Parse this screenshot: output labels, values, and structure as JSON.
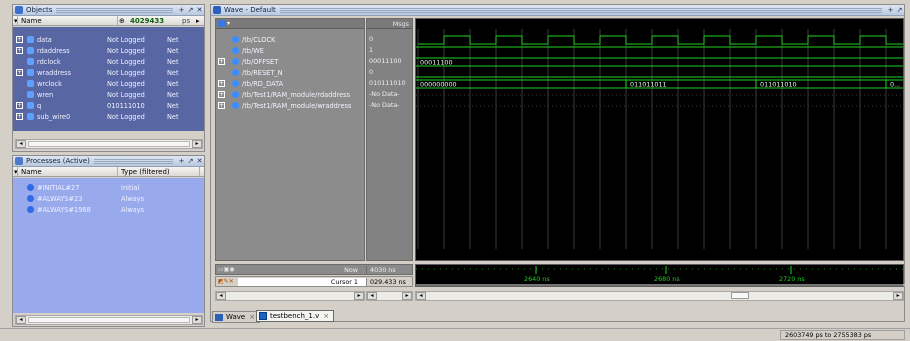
{
  "objects": {
    "title": "Objects",
    "col_name": "Name",
    "search_value": "4029433",
    "search_unit": "ps",
    "rows": [
      {
        "name": "data",
        "value": "Not Logged",
        "kind": "Net",
        "expand": true
      },
      {
        "name": "rdaddress",
        "value": "Not Logged",
        "kind": "Net",
        "expand": true
      },
      {
        "name": "rdclock",
        "value": "Not Logged",
        "kind": "Net",
        "expand": false
      },
      {
        "name": "wraddress",
        "value": "Not Logged",
        "kind": "Net",
        "expand": true
      },
      {
        "name": "wrclock",
        "value": "Not Logged",
        "kind": "Net",
        "expand": false
      },
      {
        "name": "wren",
        "value": "Not Logged",
        "kind": "Net",
        "expand": false
      },
      {
        "name": "q",
        "value": "010111010",
        "kind": "Net",
        "expand": true
      },
      {
        "name": "sub_wire0",
        "value": "Not Logged",
        "kind": "Net",
        "expand": true
      }
    ]
  },
  "processes": {
    "title": "Processes (Active)",
    "col_name": "Name",
    "col_type": "Type (filtered)",
    "rows": [
      {
        "name": "#INITIAL#27",
        "type": "Initial"
      },
      {
        "name": "#ALWAYS#23",
        "type": "Always"
      },
      {
        "name": "#ALWAYS#1968",
        "type": "Always"
      }
    ]
  },
  "wave": {
    "title": "Wave - Default",
    "msgs_header": "Msgs",
    "signals": [
      {
        "name": "/tb/CLOCK",
        "value": "0",
        "expand": false
      },
      {
        "name": "/tb/WE",
        "value": "1",
        "expand": false
      },
      {
        "name": "/tb/OFFSET",
        "value": "00011100",
        "expand": true
      },
      {
        "name": "/tb/RESET_N",
        "value": "0",
        "expand": false
      },
      {
        "name": "/tb/RD_DATA",
        "value": "010111010",
        "expand": true
      },
      {
        "name": "/tb/Test1/RAM_module/rdaddress",
        "value": "-No Data-",
        "expand": true
      },
      {
        "name": "/tb/Test1/RAM_module/wraddress",
        "value": "-No Data-",
        "expand": true
      }
    ],
    "bus_labels": {
      "offset": "00011100",
      "rd_data_0": "000000000",
      "rd_data_1": "011011011",
      "rd_data_2": "011011010",
      "rd_data_3": "0..."
    },
    "now_label": "Now",
    "now_value": "4030 ns",
    "cursor_label": "Cursor 1",
    "cursor_value": "029.433 ns",
    "time_ticks": [
      "2640 ns",
      "2680 ns",
      "2720 ns"
    ]
  },
  "tabs": {
    "wave": "Wave",
    "testbench": "testbench_1.v"
  },
  "status": {
    "range": "2603749 ps to 2755383 ps"
  },
  "colors": {
    "panel_blue": "#5a6aa8",
    "process_blue": "#97a8ec",
    "wave_green": "#1fd21f",
    "wave_bg": "#000000"
  }
}
